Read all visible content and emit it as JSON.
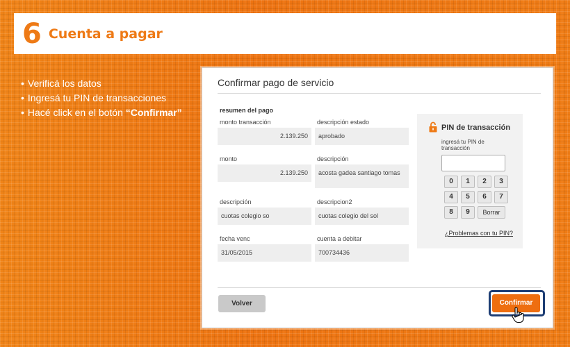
{
  "header": {
    "step": "6",
    "title": "Cuenta a pagar"
  },
  "instructions": {
    "items": [
      "Verificá los datos",
      "Ingresá tu PIN de transacciones",
      "Hacé click en el botón "
    ],
    "highlight": "“Confirmar”"
  },
  "dialog": {
    "title": "Confirmar pago de servicio",
    "summary_label": "resumen del pago",
    "fields": [
      {
        "label": "monto transacción",
        "value": "2.139.250"
      },
      {
        "label": "descripción estado",
        "value": "aprobado"
      },
      {
        "label": "monto",
        "value": "2.139.250"
      },
      {
        "label": "descripción",
        "value": "acosta gadea santiago tomas"
      },
      {
        "label": "descripción",
        "value": "cuotas colegio so"
      },
      {
        "label": "descripcion2",
        "value": "cuotas colegio del sol"
      },
      {
        "label": "fecha venc",
        "value": "31/05/2015"
      },
      {
        "label": "cuenta a debitar",
        "value": "700734436"
      }
    ],
    "pin": {
      "title": "PIN de transacción",
      "subtitle": "ingresá tu PIN de transacción",
      "input_value": "",
      "keys": [
        "0",
        "1",
        "2",
        "3",
        "4",
        "5",
        "6",
        "7",
        "8",
        "9"
      ],
      "delete_label": "Borrar",
      "help_link": "¿Problemas con tu PIN?"
    },
    "back_label": "Volver",
    "confirm_label": "Confirmar"
  },
  "colors": {
    "accent": "#ee7a16",
    "focus": "#1d3d74",
    "button_orange": "#ee6e10"
  }
}
